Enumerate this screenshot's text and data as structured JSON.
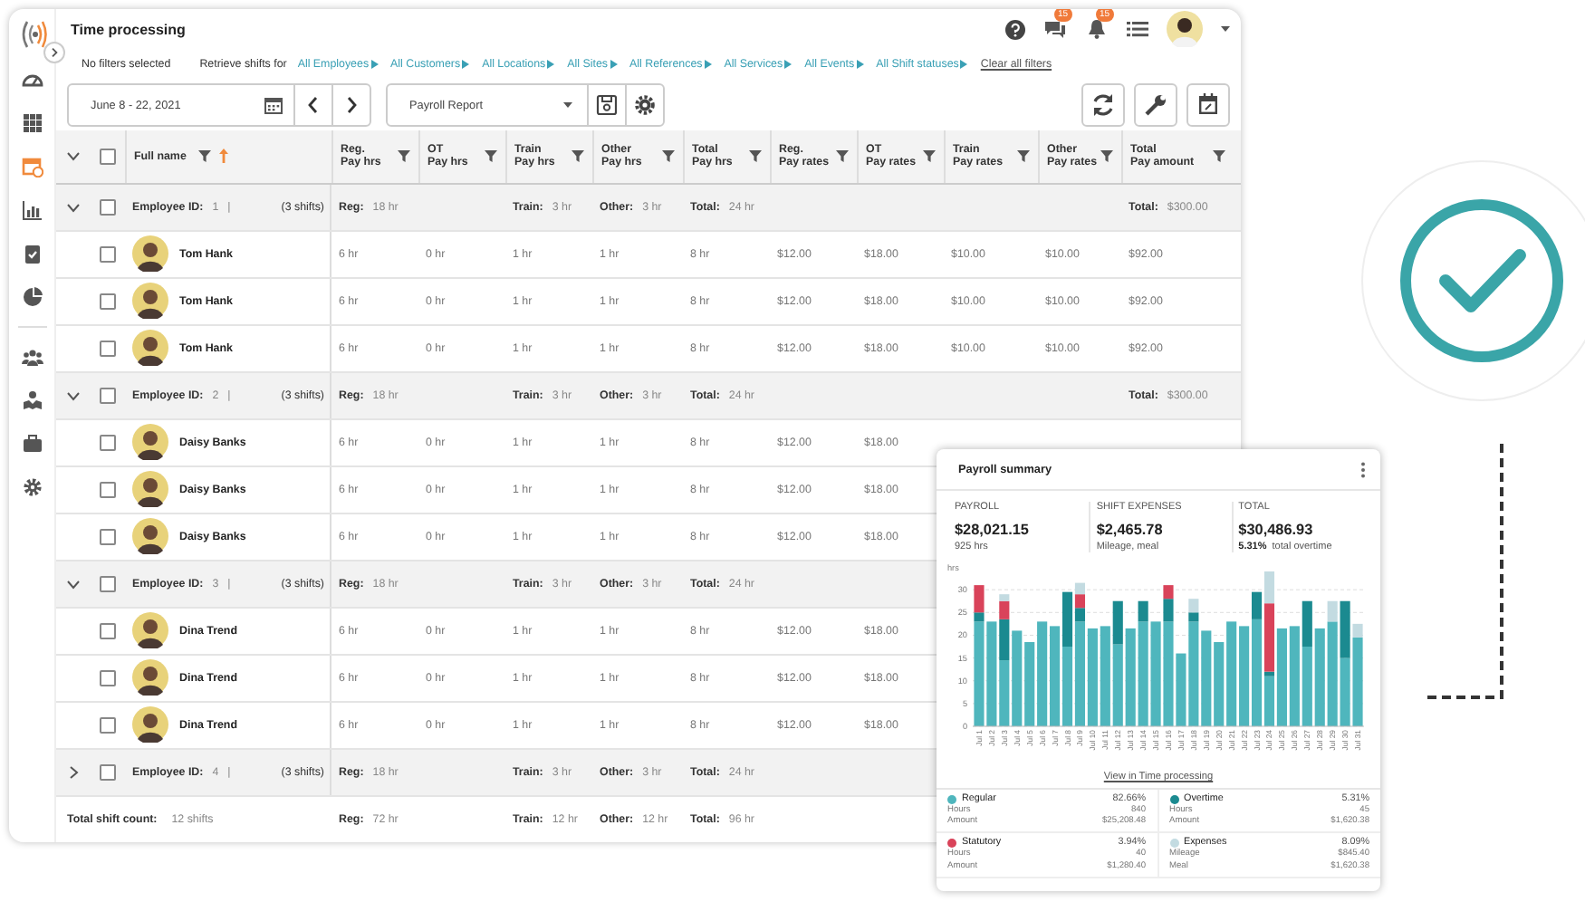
{
  "app": {
    "title": "Time processing"
  },
  "header": {
    "chat_badge": "15",
    "notification_badge": "15"
  },
  "sidebar": {
    "items": [
      {
        "kind": "dashboard",
        "selected": false
      },
      {
        "kind": "apps",
        "selected": false
      },
      {
        "kind": "calendar",
        "selected": true
      },
      {
        "kind": "chart",
        "selected": false
      },
      {
        "kind": "clipboard",
        "selected": false
      },
      {
        "kind": "pie",
        "selected": false
      },
      {
        "kind": "people",
        "selected": false
      },
      {
        "kind": "map",
        "selected": false
      },
      {
        "kind": "briefcase",
        "selected": false
      },
      {
        "kind": "settings",
        "selected": false
      }
    ]
  },
  "filters": {
    "summary": "No filters selected",
    "retrieve_label": "Retrieve shifts for",
    "links": [
      "All Employees",
      "All Customers",
      "All Locations",
      "All Sites",
      "All References",
      "All Services",
      "All Events",
      "All Shift statuses"
    ],
    "clear": "Clear all filters"
  },
  "toolbar": {
    "date_range": "June 8 - 22, 2021",
    "report": "Payroll Report"
  },
  "table": {
    "all_checked": false,
    "columns": [
      {
        "label": "Full name",
        "sorted": true
      },
      {
        "label": "Reg.\nPay hrs",
        "sorted": false
      },
      {
        "label": "OT\nPay hrs",
        "sorted": false
      },
      {
        "label": "Train\nPay hrs",
        "sorted": false
      },
      {
        "label": "Other\nPay hrs",
        "sorted": false
      },
      {
        "label": "Total\nPay hrs",
        "sorted": false
      },
      {
        "label": "Reg.\nPay rates",
        "sorted": false
      },
      {
        "label": "OT\nPay rates",
        "sorted": false
      },
      {
        "label": "Train\nPay rates",
        "sorted": false
      },
      {
        "label": "Other\nPay rates",
        "sorted": false
      },
      {
        "label": "Total\nPay amount",
        "sorted": false
      }
    ],
    "groups": [
      {
        "expanded": true,
        "checked": false,
        "id_label": "Employee ID:",
        "id": "1",
        "separator": "|",
        "shifts": "(3 shifts)",
        "totals": {
          "reg": {
            "label": "Reg:",
            "value": "18 hr"
          },
          "train": {
            "label": "Train:",
            "value": "3 hr"
          },
          "other": {
            "label": "Other:",
            "value": "3 hr"
          },
          "total": {
            "label": "Total:",
            "value": "24 hr"
          }
        },
        "amount": {
          "label": "Total:",
          "value": "$300.00"
        },
        "rows": [
          {
            "name": "Tom Hank",
            "checked": false,
            "cells": [
              "6 hr",
              "0 hr",
              "1 hr",
              "1 hr",
              "8 hr",
              "$12.00",
              "$18.00",
              "$10.00",
              "$10.00",
              "$92.00"
            ]
          },
          {
            "name": "Tom Hank",
            "checked": false,
            "cells": [
              "6 hr",
              "0 hr",
              "1 hr",
              "1 hr",
              "8 hr",
              "$12.00",
              "$18.00",
              "$10.00",
              "$10.00",
              "$92.00"
            ]
          },
          {
            "name": "Tom Hank",
            "checked": false,
            "cells": [
              "6 hr",
              "0 hr",
              "1 hr",
              "1 hr",
              "8 hr",
              "$12.00",
              "$18.00",
              "$10.00",
              "$10.00",
              "$92.00"
            ]
          }
        ]
      },
      {
        "expanded": true,
        "checked": false,
        "id_label": "Employee ID:",
        "id": "2",
        "separator": "|",
        "shifts": "(3 shifts)",
        "totals": {
          "reg": {
            "label": "Reg:",
            "value": "18 hr"
          },
          "train": {
            "label": "Train:",
            "value": "3 hr"
          },
          "other": {
            "label": "Other:",
            "value": "3 hr"
          },
          "total": {
            "label": "Total:",
            "value": "24 hr"
          }
        },
        "amount": {
          "label": "Total:",
          "value": "$300.00"
        },
        "rows": [
          {
            "name": "Daisy Banks",
            "checked": false,
            "cells": [
              "6 hr",
              "0 hr",
              "1 hr",
              "1 hr",
              "8 hr",
              "$12.00",
              "$18.00"
            ]
          },
          {
            "name": "Daisy Banks",
            "checked": false,
            "cells": [
              "6 hr",
              "0 hr",
              "1 hr",
              "1 hr",
              "8 hr",
              "$12.00",
              "$18.00"
            ]
          },
          {
            "name": "Daisy Banks",
            "checked": false,
            "cells": [
              "6 hr",
              "0 hr",
              "1 hr",
              "1 hr",
              "8 hr",
              "$12.00",
              "$18.00"
            ]
          }
        ]
      },
      {
        "expanded": true,
        "checked": false,
        "id_label": "Employee ID:",
        "id": "3",
        "separator": "|",
        "shifts": "(3 shifts)",
        "totals": {
          "reg": {
            "label": "Reg:",
            "value": "18 hr"
          },
          "train": {
            "label": "Train:",
            "value": "3 hr"
          },
          "other": {
            "label": "Other:",
            "value": "3 hr"
          },
          "total": {
            "label": "Total:",
            "value": "24 hr"
          }
        },
        "rows": [
          {
            "name": "Dina Trend",
            "checked": false,
            "cells": [
              "6 hr",
              "0 hr",
              "1 hr",
              "1 hr",
              "8 hr",
              "$12.00",
              "$18.00"
            ]
          },
          {
            "name": "Dina Trend",
            "checked": false,
            "cells": [
              "6 hr",
              "0 hr",
              "1 hr",
              "1 hr",
              "8 hr",
              "$12.00",
              "$18.00"
            ]
          },
          {
            "name": "Dina Trend",
            "checked": false,
            "cells": [
              "6 hr",
              "0 hr",
              "1 hr",
              "1 hr",
              "8 hr",
              "$12.00",
              "$18.00"
            ]
          }
        ]
      },
      {
        "expanded": false,
        "checked": false,
        "id_label": "Employee ID:",
        "id": "4",
        "separator": "|",
        "shifts": "(3 shifts)",
        "totals": {
          "reg": {
            "label": "Reg:",
            "value": "18 hr"
          },
          "train": {
            "label": "Train:",
            "value": "3 hr"
          },
          "other": {
            "label": "Other:",
            "value": "3 hr"
          },
          "total": {
            "label": "Total:",
            "value": "24 hr"
          }
        }
      }
    ],
    "footer": {
      "label": "Total shift count:",
      "value": "12 shifts",
      "totals": {
        "reg": {
          "label": "Reg:",
          "value": "72 hr"
        },
        "train": {
          "label": "Train:",
          "value": "12 hr"
        },
        "other": {
          "label": "Other:",
          "value": "12 hr"
        },
        "total": {
          "label": "Total:",
          "value": "96 hr"
        }
      }
    }
  },
  "summary": {
    "title": "Payroll summary",
    "stats": [
      {
        "label": "PAYROLL",
        "value": "$28,021.15",
        "note": "925 hrs"
      },
      {
        "label": "SHIFT EXPENSES",
        "value": "$2,465.78",
        "note": "Mileage, meal"
      },
      {
        "label": "TOTAL",
        "value": "$30,486.93",
        "note_strong": "5.31%",
        "note": "total overtime"
      }
    ],
    "chart_data": {
      "type": "bar",
      "stacked": true,
      "grid": true,
      "ylabel": "hrs",
      "ylim": [
        0,
        35
      ],
      "yticks": [
        0,
        5,
        10,
        15,
        20,
        25,
        30
      ],
      "categories": [
        "Jul 1",
        "Jul 2",
        "Jul 3",
        "Jul 4",
        "Jul 5",
        "Jul 6",
        "Jul 7",
        "Jul 8",
        "Jul 9",
        "Jul 10",
        "Jul 11",
        "Jul 12",
        "Jul 13",
        "Jul 14",
        "Jul 15",
        "Jul 16",
        "Jul 17",
        "Jul 18",
        "Jul 19",
        "Jul 20",
        "Jul 21",
        "Jul 22",
        "Jul 23",
        "Jul 24",
        "Jul 25",
        "Jul 26",
        "Jul 27",
        "Jul 28",
        "Jul 29",
        "Jul 30",
        "Jul 31"
      ],
      "series": [
        {
          "color": "#4fb6bd",
          "values": [
            23,
            23,
            14.5,
            21,
            18.5,
            23,
            22,
            17.5,
            23,
            21.5,
            22,
            18,
            21.5,
            23,
            23,
            23,
            16,
            23,
            21,
            18.5,
            23,
            22,
            23.5,
            11,
            21.5,
            22,
            17.5,
            21.5,
            23,
            15,
            19.5
          ]
        },
        {
          "color": "#1b8a90",
          "values": [
            2,
            0,
            9,
            0,
            0,
            0,
            0,
            12,
            3,
            0,
            0,
            9.5,
            0,
            4.5,
            0,
            5,
            0,
            2,
            0,
            0,
            0,
            0,
            6,
            1,
            0,
            0,
            10,
            0,
            0,
            12.5,
            0
          ]
        },
        {
          "color": "#d9435a",
          "values": [
            6,
            0,
            4,
            0,
            0,
            0,
            0,
            0,
            3,
            0,
            0,
            0,
            0,
            0,
            0,
            3,
            0,
            0,
            0,
            0,
            0,
            0,
            0,
            15,
            0,
            0,
            0,
            0,
            0,
            0,
            0
          ]
        },
        {
          "color": "#c3dbe1",
          "values": [
            0,
            0,
            1.5,
            0,
            0,
            0,
            0,
            0,
            2.5,
            0,
            0,
            0,
            0,
            0,
            0,
            0,
            0,
            3,
            0,
            0,
            0,
            0,
            0,
            7,
            0,
            0,
            0,
            0,
            4.5,
            0,
            3
          ]
        }
      ]
    },
    "link": "View in Time processing",
    "legend": [
      {
        "name": "Regular",
        "color": "#4fb6bd",
        "percent": "82.66%",
        "lines": [
          {
            "label": "Hours",
            "value": "840"
          },
          {
            "label": "Amount",
            "value": "$25,208.48"
          }
        ]
      },
      {
        "name": "Overtime",
        "color": "#1b8a90",
        "percent": "5.31%",
        "lines": [
          {
            "label": "Hours",
            "value": "45"
          },
          {
            "label": "Amount",
            "value": "$1,620.38"
          }
        ]
      },
      {
        "name": "Statutory",
        "color": "#d9435a",
        "percent": "3.94%",
        "lines": [
          {
            "label": "Hours",
            "value": "40"
          },
          {
            "label": "Amount",
            "value": "$1,280.40"
          }
        ]
      },
      {
        "name": "Expenses",
        "color": "#c3dbe1",
        "percent": "8.09%",
        "lines": [
          {
            "label": "Mileage",
            "value": "$845.40"
          },
          {
            "label": "Meal",
            "value": "$1,620.38"
          }
        ]
      }
    ]
  }
}
